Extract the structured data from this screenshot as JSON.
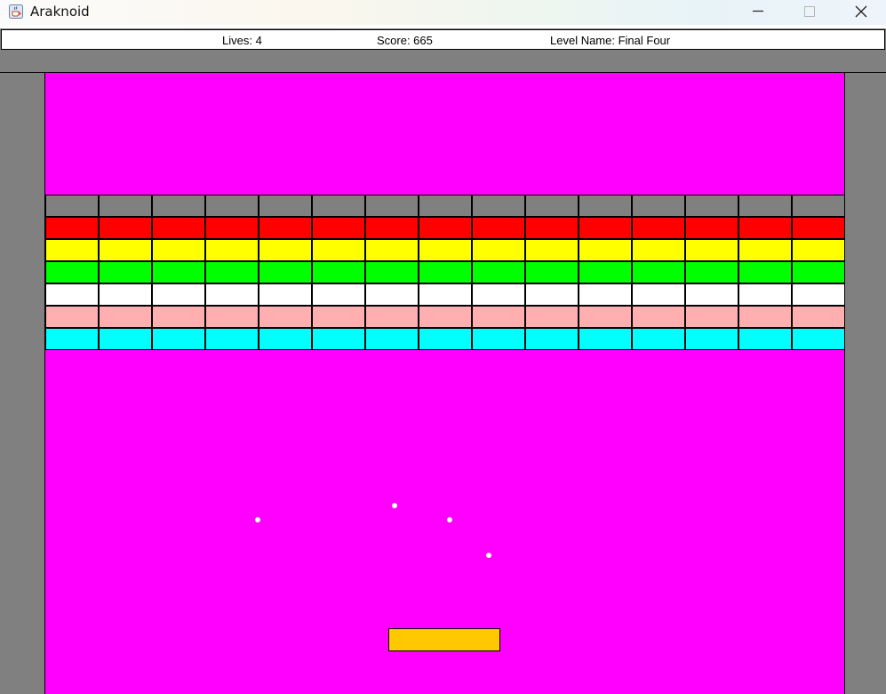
{
  "window": {
    "title": "Araknoid",
    "app_icon": "java-cup-icon",
    "buttons": [
      "minimize-icon",
      "maximize-icon",
      "close-icon"
    ]
  },
  "hud": {
    "lives_text": "Lives: 4",
    "score_text": "Score: 665",
    "level_text": "Level Name: Final Four",
    "lives": 4,
    "score": 665,
    "level_name": "Final Four"
  },
  "colors": {
    "background": "#ff00ff",
    "walls": "#808080",
    "ball": "#ffffff",
    "paddle": "#ffc800"
  },
  "bricks": {
    "columns": 15,
    "rows": [
      {
        "color": "#808080"
      },
      {
        "color": "#ff0000"
      },
      {
        "color": "#ffff00"
      },
      {
        "color": "#00ff00"
      },
      {
        "color": "#ffffff"
      },
      {
        "color": "#ffafaf"
      },
      {
        "color": "#00ffff"
      }
    ]
  },
  "balls": {
    "count": 4
  }
}
